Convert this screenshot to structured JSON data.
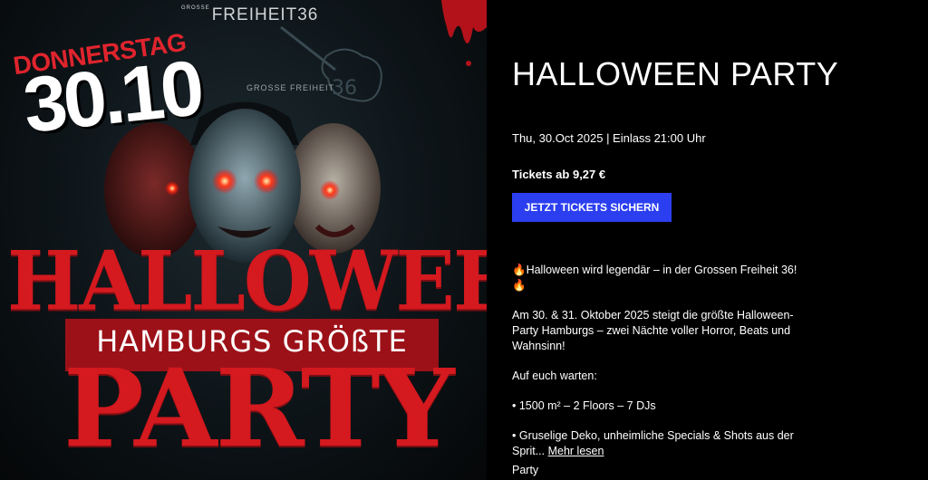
{
  "poster": {
    "brand": "FREIHEIT36",
    "brand_prefix": "GROSSE",
    "sign": "GROSSE FREIHEIT",
    "guitar_number": "36",
    "day": "DONNERSTAG",
    "date": "30.10",
    "headline": "HALLOWEEN",
    "subline": "HAMBURGS GRÖßTE",
    "party": "PARTY"
  },
  "event": {
    "title": "HALLOWEEN PARTY",
    "meta": "Thu, 30.Oct 2025 | Einlass 21:00 Uhr",
    "price": "Tickets ab 9,27 €",
    "cta": "JETZT TICKETS SICHERN"
  },
  "description": {
    "p1": "🔥Halloween wird legendär – in der Grossen Freiheit 36!🔥",
    "p2": "Am 30. & 31. Oktober 2025 steigt die größte Halloween-Party Hamburgs – zwei Nächte voller Horror, Beats und Wahnsinn!",
    "p3": "Auf euch warten:",
    "p4": "• 1500 m² – 2 Floors – 7 DJs",
    "p5": "• Gruselige Deko, unheimliche Specials & Shots aus der Sprit...",
    "more": "Mehr lesen"
  },
  "category": "Party",
  "colors": {
    "accent_button": "#2b3ff0",
    "poster_red": "#d4191f",
    "background": "#000000"
  }
}
